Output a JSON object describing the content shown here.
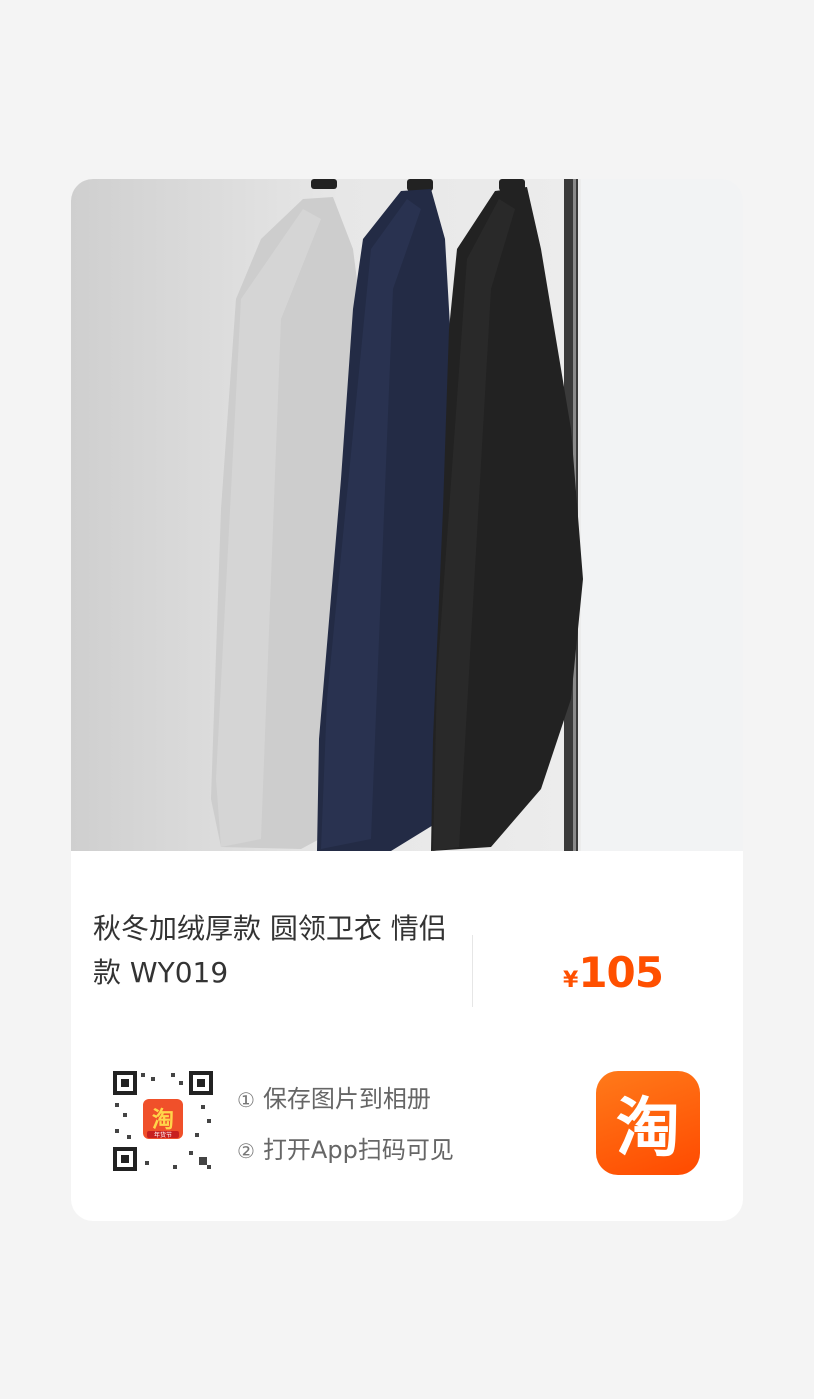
{
  "product": {
    "title": "秋冬加绒厚款 圆领卫衣 情侣款 WY019",
    "currency_symbol": "¥",
    "price": "105",
    "image_alt": "three crewneck sweatshirts (light grey, navy, black) hanging on a rail"
  },
  "steps": {
    "step1_number": "①",
    "step1_text": "保存图片到相册",
    "step2_number": "②",
    "step2_text": "打开App扫码可见"
  },
  "qr": {
    "center_logo_text": "淘",
    "center_logo_subtext": "年货节"
  },
  "app_logo": {
    "text": "淘",
    "icon": "taobao-app-icon"
  },
  "colors": {
    "accent": "#ff5000",
    "card_background": "#ffffff",
    "page_background": "#f4f4f4"
  }
}
